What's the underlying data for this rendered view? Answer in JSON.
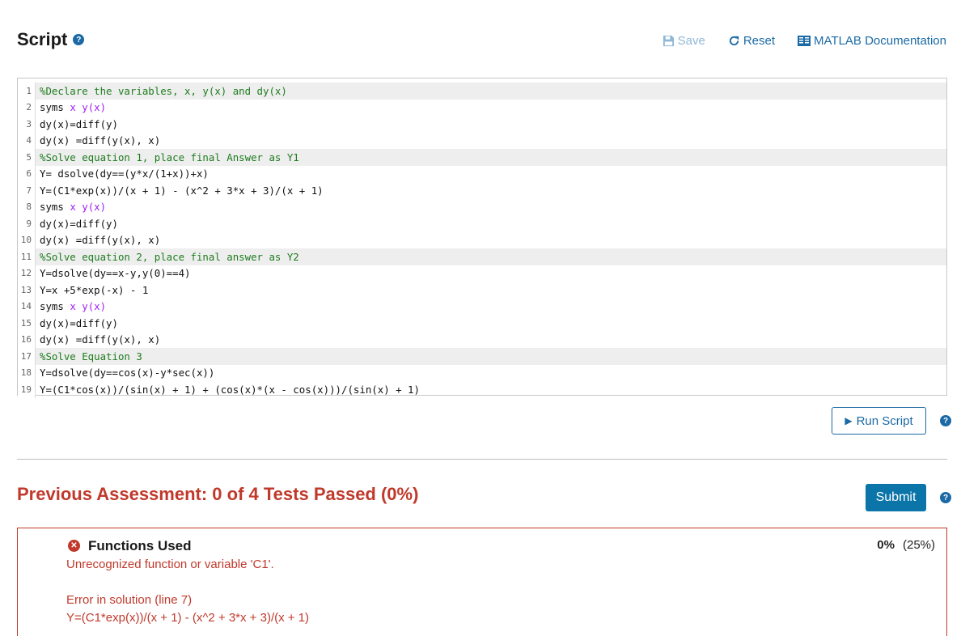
{
  "header": {
    "title": "Script",
    "help": "?",
    "save_label": "Save",
    "reset_label": "Reset",
    "docs_label": "MATLAB Documentation"
  },
  "editor": {
    "lines": [
      {
        "n": "1",
        "parts": [
          {
            "t": "%Declare the variables, x, y(x) and dy(x)",
            "c": "comment"
          }
        ],
        "hl": true
      },
      {
        "n": "2",
        "parts": [
          {
            "t": "syms ",
            "c": ""
          },
          {
            "t": "x y(x)",
            "c": "var"
          }
        ],
        "hl": false
      },
      {
        "n": "3",
        "parts": [
          {
            "t": "dy(x)=diff(y)",
            "c": ""
          }
        ],
        "hl": false
      },
      {
        "n": "4",
        "parts": [
          {
            "t": "dy(x) =diff(y(x), x)",
            "c": ""
          }
        ],
        "hl": false
      },
      {
        "n": "5",
        "parts": [
          {
            "t": "%Solve equation 1, place final Answer as Y1",
            "c": "comment"
          }
        ],
        "hl": true
      },
      {
        "n": "6",
        "parts": [
          {
            "t": "Y= dsolve(dy==(y*x/(1+x))+x)",
            "c": ""
          }
        ],
        "hl": false
      },
      {
        "n": "7",
        "parts": [
          {
            "t": "Y=(C1*exp(x))/(x + 1) - (x^2 + 3*x + 3)/(x + 1)",
            "c": ""
          }
        ],
        "hl": false
      },
      {
        "n": "8",
        "parts": [
          {
            "t": "syms ",
            "c": ""
          },
          {
            "t": "x y(x)",
            "c": "var"
          }
        ],
        "hl": false
      },
      {
        "n": "9",
        "parts": [
          {
            "t": "dy(x)=diff(y)",
            "c": ""
          }
        ],
        "hl": false
      },
      {
        "n": "10",
        "parts": [
          {
            "t": "dy(x) =diff(y(x), x)",
            "c": ""
          }
        ],
        "hl": false
      },
      {
        "n": "11",
        "parts": [
          {
            "t": "%Solve equation 2, place final answer as Y2",
            "c": "comment"
          }
        ],
        "hl": true
      },
      {
        "n": "12",
        "parts": [
          {
            "t": "Y=dsolve(dy==x-y,y(0)==4)",
            "c": ""
          }
        ],
        "hl": false
      },
      {
        "n": "13",
        "parts": [
          {
            "t": "Y=x +5*exp(-x) - 1",
            "c": ""
          }
        ],
        "hl": false
      },
      {
        "n": "14",
        "parts": [
          {
            "t": "syms ",
            "c": ""
          },
          {
            "t": "x y(x)",
            "c": "var"
          }
        ],
        "hl": false
      },
      {
        "n": "15",
        "parts": [
          {
            "t": "dy(x)=diff(y)",
            "c": ""
          }
        ],
        "hl": false
      },
      {
        "n": "16",
        "parts": [
          {
            "t": "dy(x) =diff(y(x), x)",
            "c": ""
          }
        ],
        "hl": false
      },
      {
        "n": "17",
        "parts": [
          {
            "t": "%Solve Equation 3",
            "c": "comment"
          }
        ],
        "hl": true
      },
      {
        "n": "18",
        "parts": [
          {
            "t": "Y=dsolve(dy==cos(x)-y*sec(x))",
            "c": ""
          }
        ],
        "hl": false
      },
      {
        "n": "19",
        "parts": [
          {
            "t": "Y=(C1*cos(x))/(sin(x) + 1) + (cos(x)*(x - cos(x)))/(sin(x) + 1)",
            "c": ""
          }
        ],
        "hl": false
      }
    ]
  },
  "run": {
    "label": "Run Script",
    "help": "?"
  },
  "assessment": {
    "title": "Previous Assessment: 0 of 4 Tests Passed (0%)",
    "submit_label": "Submit",
    "submit_help": "?",
    "result": {
      "icon": "✕",
      "name": "Functions Used",
      "score": "0%",
      "weight": "(25%)",
      "message": "Unrecognized function or variable 'C1'.",
      "error_line": "Error in solution (line 7)",
      "error_code": "Y=(C1*exp(x))/(x + 1) - (x^2 + 3*x + 3)/(x + 1)"
    }
  },
  "colors": {
    "accent": "#1b6aa5",
    "error": "#c0392b",
    "comment": "#1e7c1e",
    "variable": "#a020f0"
  }
}
